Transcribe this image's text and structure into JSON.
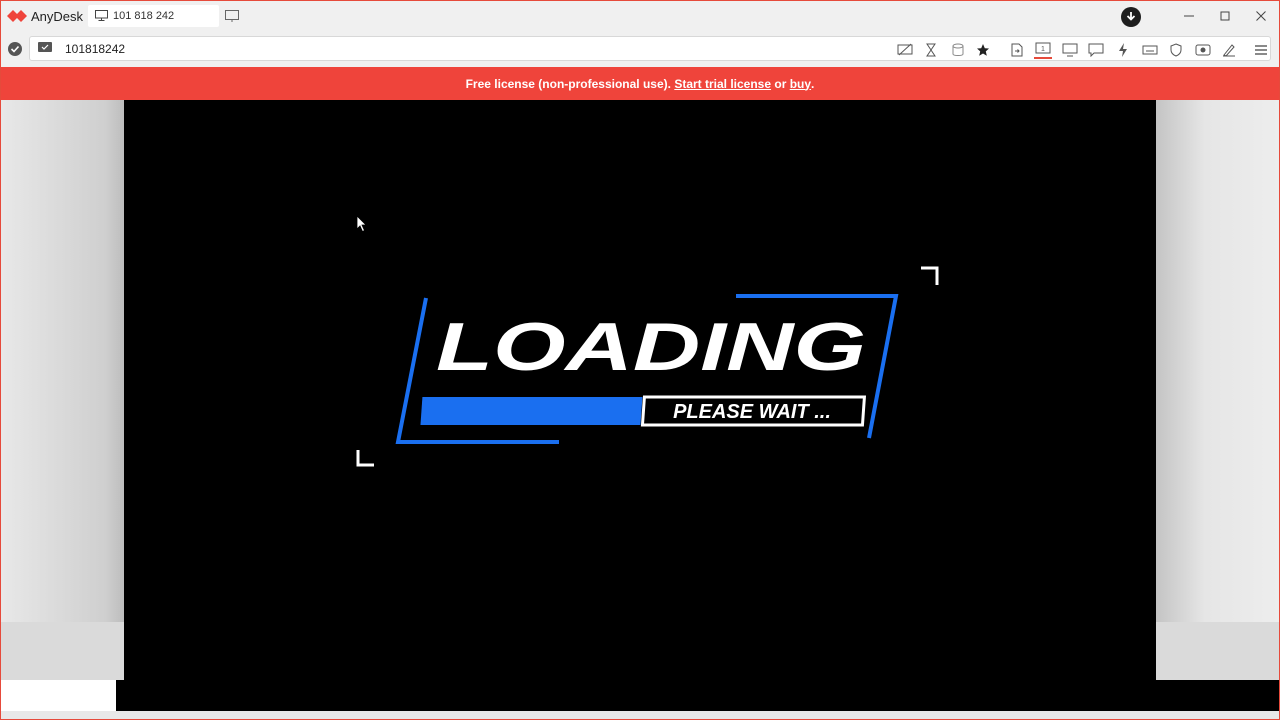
{
  "app": {
    "name": "AnyDesk",
    "tab_label": "101 818 242",
    "address_value": "101818242",
    "accent_color": "#ef443b"
  },
  "toolbar": {
    "icons": [
      "privacy-icon",
      "hourglass-icon",
      "database-icon",
      "star-icon",
      "file-transfer-icon",
      "monitor-select-icon",
      "display-icon",
      "chat-icon",
      "actions-icon",
      "keyboard-icon",
      "permissions-icon",
      "record-icon",
      "whiteboard-icon",
      "menu-icon"
    ]
  },
  "banner": {
    "prefix": "Free license (non-professional use). ",
    "trial_link": "Start trial license",
    "middle": " or ",
    "buy_link": "buy",
    "suffix": "."
  },
  "remote": {
    "loading_title": "LOADING",
    "loading_subtitle": "PLEASE WAIT ...",
    "progress_fraction": 0.5,
    "progress_color": "#1a6ff0"
  }
}
